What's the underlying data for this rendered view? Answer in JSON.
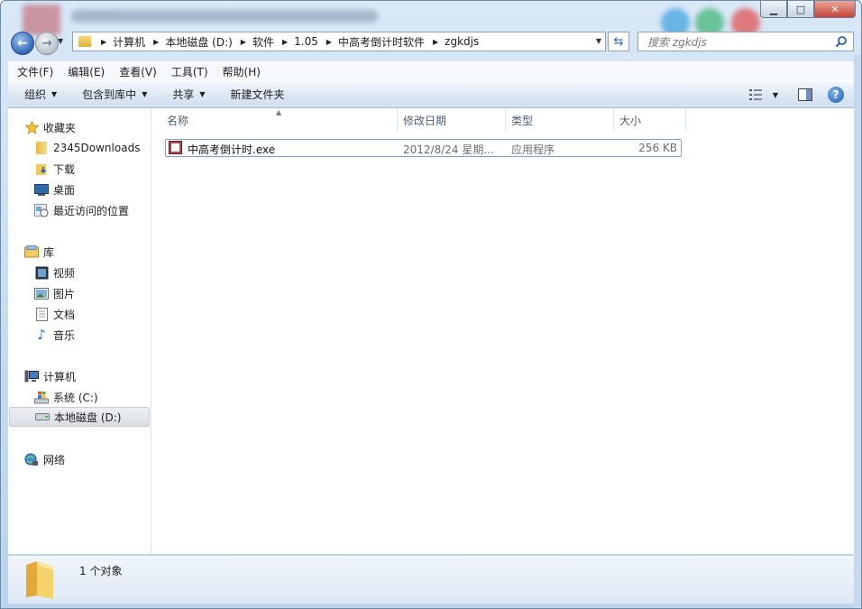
{
  "window": {
    "caption": {
      "minimize": "▁",
      "maximize": "□",
      "close": "✕"
    }
  },
  "address": {
    "crumbs": [
      "计算机",
      "本地磁盘 (D:)",
      "软件",
      "1.05",
      "中高考倒计时软件",
      "zgkdjs"
    ]
  },
  "search": {
    "placeholder": "搜索 zgkdjs"
  },
  "menu": {
    "file": "文件(F)",
    "edit": "编辑(E)",
    "view": "查看(V)",
    "tools": "工具(T)",
    "help": "帮助(H)"
  },
  "toolbar": {
    "organize": "组织",
    "include": "包含到库中",
    "share": "共享",
    "new_folder": "新建文件夹"
  },
  "sidebar": {
    "favorites": "收藏夹",
    "fav_items": [
      "2345Downloads",
      "下载",
      "桌面",
      "最近访问的位置"
    ],
    "libraries": "库",
    "lib_items": [
      "视频",
      "图片",
      "文档",
      "音乐"
    ],
    "computer": "计算机",
    "comp_items": [
      "系统 (C:)",
      "本地磁盘 (D:)"
    ],
    "network": "网络"
  },
  "columns": {
    "name": "名称",
    "date": "修改日期",
    "type": "类型",
    "size": "大小"
  },
  "files": [
    {
      "name": "中高考倒计时.exe",
      "date": "2012/8/24 星期...",
      "type": "应用程序",
      "size": "256 KB"
    }
  ],
  "status": {
    "count": "1 个对象"
  },
  "colors": {
    "accent": "#2d66b8",
    "selection_border": "#7da2ce",
    "app_icon": "#b84450"
  }
}
